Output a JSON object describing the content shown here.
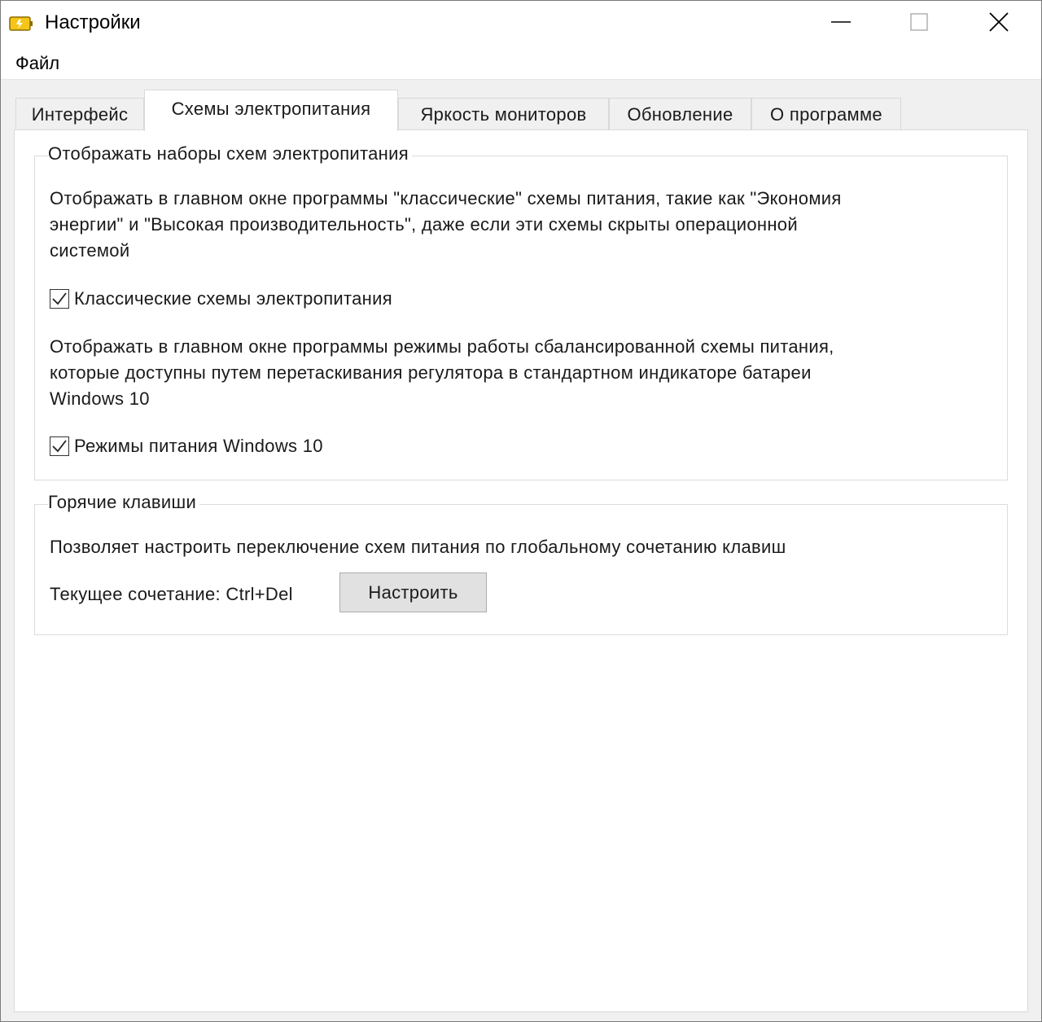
{
  "window": {
    "title": "Настройки",
    "icon": "battery-icon",
    "controls": {
      "minimize": "minimize-icon",
      "maximize": "maximize-icon",
      "close": "close-icon"
    }
  },
  "menu": {
    "file": "Файл"
  },
  "tabs": [
    {
      "label": "Интерфейс",
      "active": false
    },
    {
      "label": "Схемы электропитания",
      "active": true
    },
    {
      "label": "Яркость мониторов",
      "active": false
    },
    {
      "label": "Обновление",
      "active": false
    },
    {
      "label": "О программе",
      "active": false
    }
  ],
  "power_schemes_group": {
    "title": "Отображать наборы схем электропитания",
    "classic_description_lines": [
      "Отображать в главном окне программы \"классические\" схемы питания, такие как \"Экономия",
      "энергии\" и \"Высокая производительность\", даже если эти схемы скрыты операционной",
      "системой"
    ],
    "classic_checkbox": {
      "label": "Классические схемы электропитания",
      "checked": true
    },
    "modes_description_lines": [
      "Отображать в главном окне программы режимы работы сбалансированной схемы питания,",
      "которые доступны путем перетаскивания регулятора в стандартном индикаторе батареи",
      "Windows 10"
    ],
    "modes_checkbox": {
      "label": "Режимы питания Windows 10",
      "checked": true
    }
  },
  "hotkeys_group": {
    "title": "Горячие клавиши",
    "description": "Позволяет настроить переключение схем питания по глобальному сочетанию клавиш",
    "current_label": "Текущее сочетание: Ctrl+Del",
    "configure_button": "Настроить"
  },
  "colors": {
    "window_bg": "#ffffff",
    "client_bg": "#f0f0f0",
    "button_bg": "#e1e1e1",
    "battery_fill": "#f5c518"
  }
}
